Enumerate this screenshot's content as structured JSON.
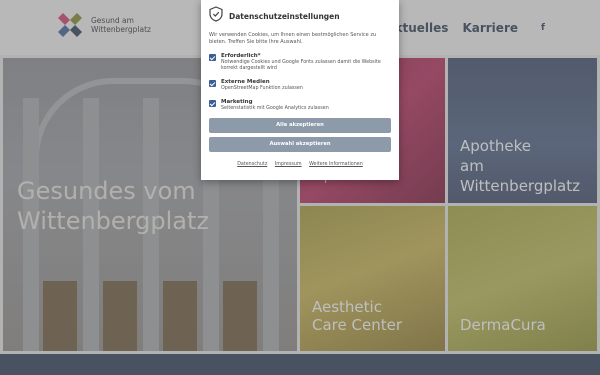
{
  "header": {
    "logo_line1": "Gesund am",
    "logo_line2": "Wittenbergplatz",
    "nav": [
      "Aktuelles",
      "Karriere"
    ],
    "social_label": "f"
  },
  "hero": {
    "title_line1": "Gesundes vom",
    "title_line2": "Wittenbergplatz"
  },
  "tiles": {
    "apotheke1": "Apotheke",
    "apotheke2_line1": "Apotheke",
    "apotheke2_line2": "am",
    "apotheke2_line3": "Wittenbergplatz",
    "aesthetic_line1": "Aesthetic",
    "aesthetic_line2": "Care Center",
    "dermacura": "DermaCura"
  },
  "consent": {
    "title": "Datenschutzeinstellungen",
    "intro": "Wir verwenden Cookies, um Ihnen einen bestmöglichen Service zu bieten. Treffen Sie bitte Ihre Auswahl.",
    "options": [
      {
        "name": "Erforderlich*",
        "desc": "Notwendige Cookies und Google Fonts zulassen damit die Website korrekt dargestellt wird",
        "checked": true
      },
      {
        "name": "Externe Medien",
        "desc": "OpenStreetMap Funktion zulassen",
        "checked": true
      },
      {
        "name": "Marketing",
        "desc": "Seitenstatistik mit Google Analytics zulassen",
        "checked": true
      }
    ],
    "accept_all": "Alle akzeptieren",
    "accept_selection": "Auswahl akzeptieren",
    "links": [
      "Datenschutz",
      "Impressum",
      "Weitere Informationen"
    ]
  },
  "colors": {
    "brand_navy": "#2b3b54",
    "button_gray": "#8c9aa9",
    "checkbox_blue": "#3a5f96"
  }
}
